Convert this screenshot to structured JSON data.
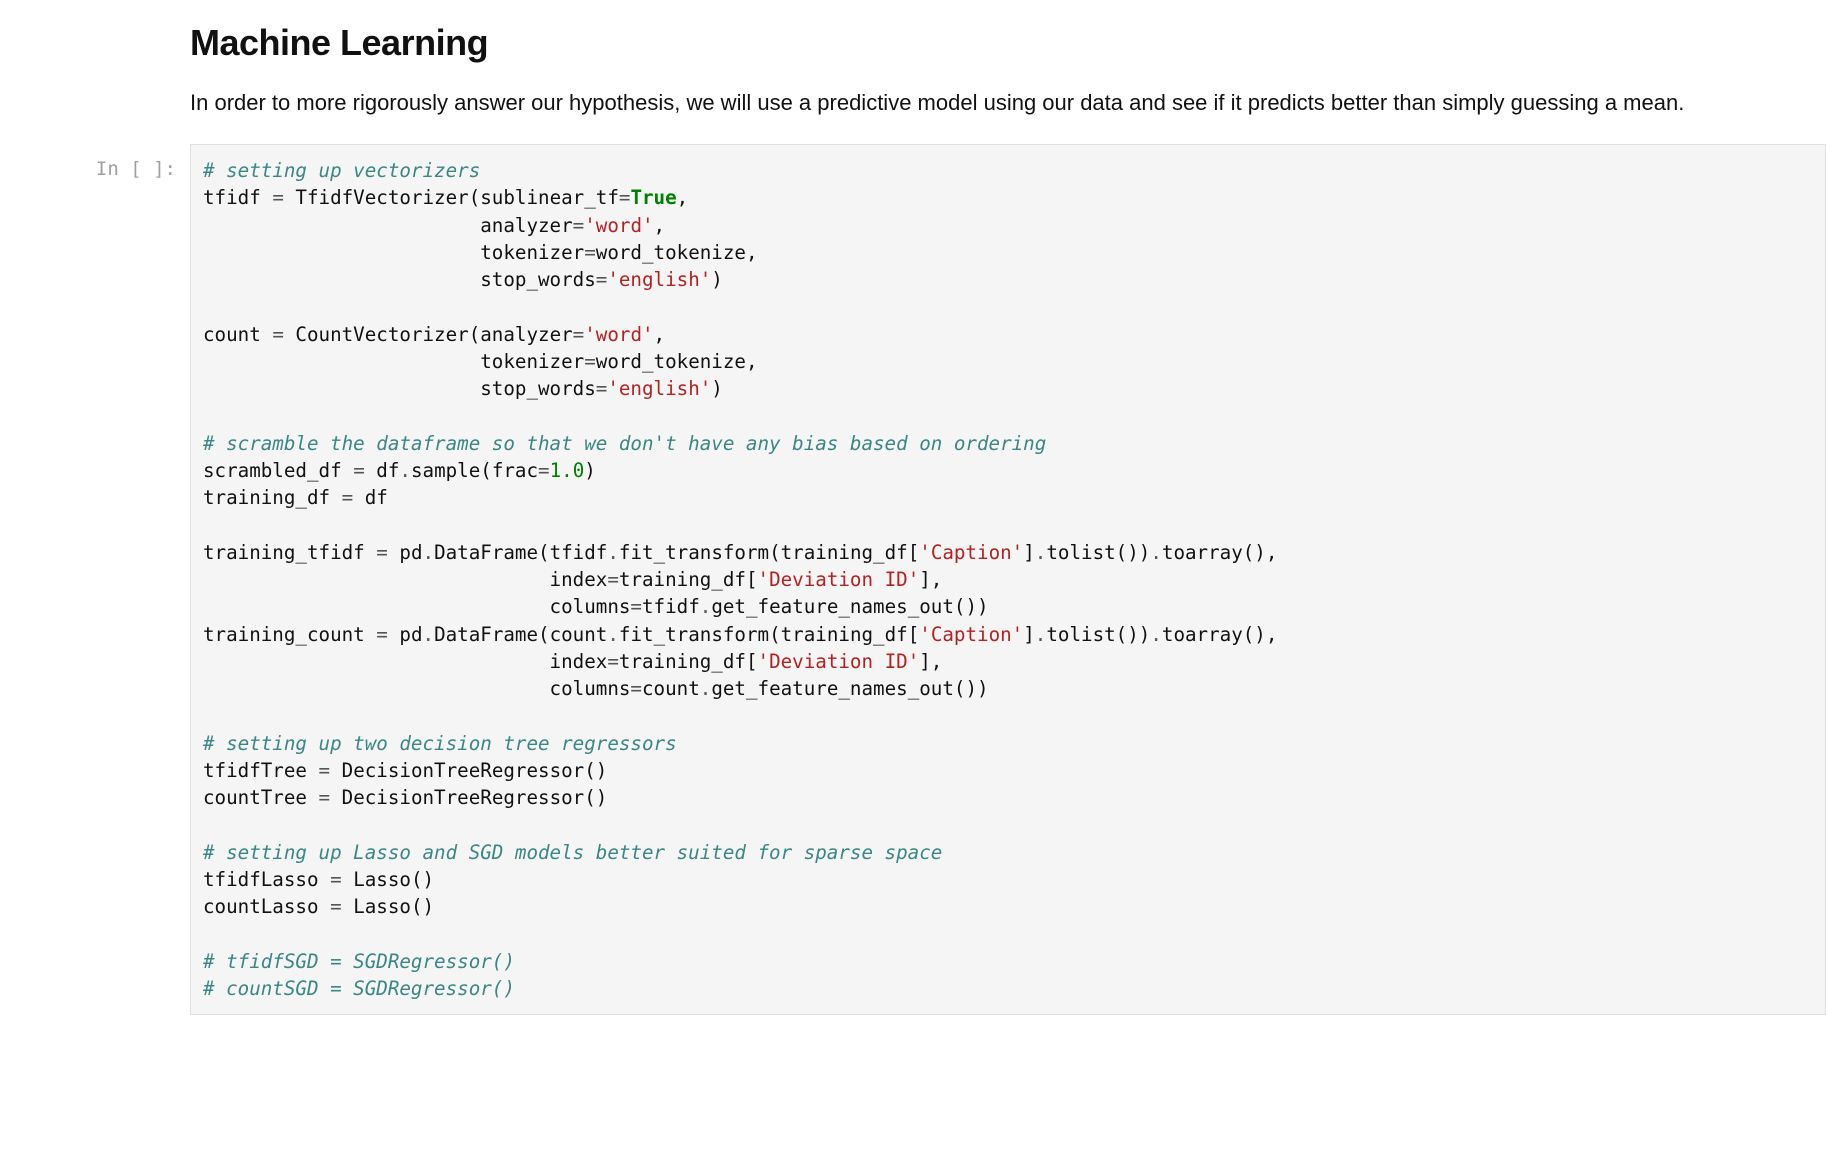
{
  "heading": "Machine Learning",
  "paragraph": "In order to more rigorously answer our hypothesis, we will use a predictive model using our data and see if it predicts better than simply guessing a mean.",
  "prompt": "In [ ]:",
  "code": {
    "c1": "# setting up vectorizers",
    "l2a": "tfidf ",
    "l2b": " TfidfVectorizer(sublinear_tf",
    "l2c": "True",
    "l3a": "                        analyzer",
    "l3b": "'word'",
    "l4a": "                        tokenizer",
    "l4b": "word_tokenize,",
    "l5a": "                        stop_words",
    "l5b": "'english'",
    "l7a": "count ",
    "l7b": " CountVectorizer(analyzer",
    "l7c": "'word'",
    "l8a": "                        tokenizer",
    "l8b": "word_tokenize,",
    "l9a": "                        stop_words",
    "l9b": "'english'",
    "c10": "# scramble the dataframe so that we don't have any bias based on ordering",
    "l11a": "scrambled_df ",
    "l11b": " df",
    "l11c": "sample(frac",
    "l11d": "1.0",
    "l12a": "training_df ",
    "l12b": " df",
    "l14a": "training_tfidf ",
    "l14b": " pd",
    "l14c": "DataFrame(tfidf",
    "l14d": "fit_transform(training_df[",
    "l14e": "'Caption'",
    "l14f": "tolist())",
    "l14g": "toarray(),",
    "l15a": "                              index",
    "l15b": "training_df[",
    "l15c": "'Deviation ID'",
    "l16a": "                              columns",
    "l16b": "tfidf",
    "l16c": "get_feature_names_out())",
    "l17a": "training_count ",
    "l17b": " pd",
    "l17c": "DataFrame(count",
    "l17d": "fit_transform(training_df[",
    "l17e": "'Caption'",
    "l17f": "tolist())",
    "l17g": "toarray(),",
    "l18a": "                              index",
    "l18b": "training_df[",
    "l18c": "'Deviation ID'",
    "l19a": "                              columns",
    "l19b": "count",
    "l19c": "get_feature_names_out())",
    "c20": "# setting up two decision tree regressors",
    "l21a": "tfidfTree ",
    "l21b": " DecisionTreeRegressor()",
    "l22a": "countTree ",
    "l22b": " DecisionTreeRegressor()",
    "c23": "# setting up Lasso and SGD models better suited for sparse space",
    "l24a": "tfidfLasso ",
    "l24b": " Lasso()",
    "l25a": "countLasso ",
    "l25b": " Lasso()",
    "c26": "# tfidfSGD = SGDRegressor()",
    "c27": "# countSGD = SGDRegressor()"
  }
}
